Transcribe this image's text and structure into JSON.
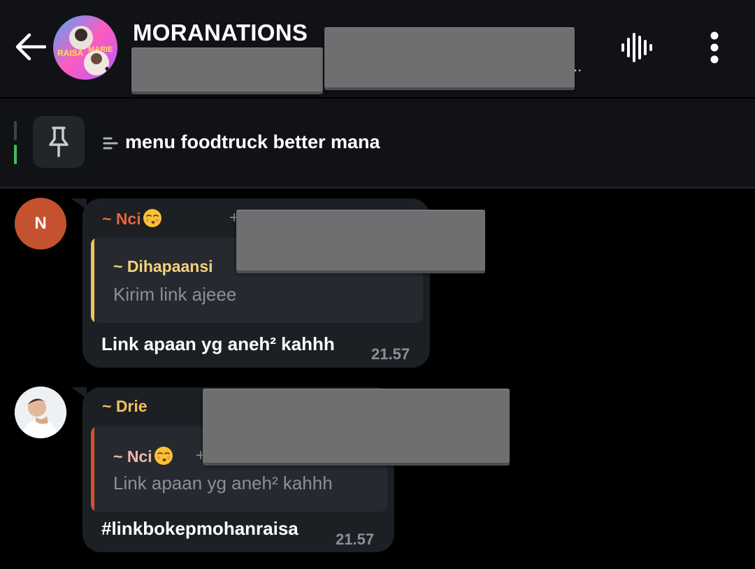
{
  "header": {
    "back_icon": "arrow-left-icon",
    "title": "MORANATIONS",
    "subtitle_ellipsis": "..",
    "voice_chat_icon": "voice-wave-icon",
    "menu_icon": "more-vertical-icon",
    "avatar_text_top": "RAISA",
    "avatar_text_right": "MARIE"
  },
  "pinned": {
    "icon": "pin-icon",
    "text_icon": "text-lines-icon",
    "text": "menu foodtruck better mana",
    "indicator_active_color": "#3fbf5a"
  },
  "messages": [
    {
      "sender": "~ Nci",
      "sender_color": "#e8663a",
      "avatar_letter": "N",
      "avatar_color": "#c5522e",
      "sender_emoji": "kissing-face-emoji",
      "reply": {
        "name": "~ Dihapaansi",
        "name_color": "#f5d27a",
        "bar_color": "#f5c05a",
        "text": "Kirim link ajeee"
      },
      "text": "Link apaan yg aneh² kahhh",
      "time": "21.57"
    },
    {
      "sender": "~ Drie",
      "sender_color": "#f5c05a",
      "avatar_icon": "user-photo-avatar",
      "reply": {
        "name": "~ Nci",
        "name_color": "#f0b8a8",
        "bar_color": "#d0532c",
        "name_emoji": "kissing-face-emoji",
        "plus": "+",
        "text": "Link apaan yg aneh² kahhh"
      },
      "text": "#linkbokepmohanraisa",
      "time": "21.57"
    }
  ]
}
